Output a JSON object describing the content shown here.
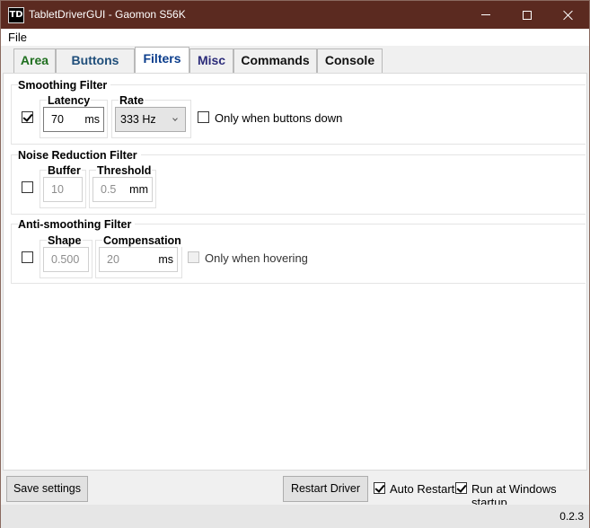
{
  "window": {
    "app_icon": "TD",
    "title": "TabletDriverGUI - Gaomon S56K",
    "controls": [
      "minimize-icon",
      "maximize-icon",
      "close-icon"
    ]
  },
  "menu": {
    "file": "File"
  },
  "tabs": [
    {
      "label": "Area",
      "color": "#1f6f1f"
    },
    {
      "label": "Buttons",
      "color": "#1f4e7a"
    },
    {
      "label": "Filters",
      "color": "#0b3d8c",
      "active": true
    },
    {
      "label": "Misc",
      "color": "#2c2c7a"
    },
    {
      "label": "Commands",
      "color": "#111111"
    },
    {
      "label": "Console",
      "color": "#111111"
    }
  ],
  "smoothing": {
    "title": "Smoothing Filter",
    "enabled": true,
    "latency_label": "Latency",
    "latency_value": "70",
    "latency_unit": "ms",
    "rate_label": "Rate",
    "rate_value": "333 Hz",
    "only_buttons_label": "Only when buttons down",
    "only_buttons_checked": false
  },
  "noise": {
    "title": "Noise Reduction Filter",
    "enabled": false,
    "buffer_label": "Buffer",
    "buffer_value": "10",
    "threshold_label": "Threshold",
    "threshold_value": "0.5",
    "threshold_unit": "mm"
  },
  "antismoothing": {
    "title": "Anti-smoothing Filter",
    "enabled": false,
    "shape_label": "Shape",
    "shape_value": "0.500",
    "compensation_label": "Compensation",
    "compensation_value": "20",
    "compensation_unit": "ms",
    "only_hovering_label": "Only when hovering",
    "only_hovering_checked": false
  },
  "bottom": {
    "save_label": "Save settings",
    "restart_label": "Restart Driver",
    "auto_restart_label": "Auto Restart",
    "auto_restart_checked": true,
    "startup_label": "Run at Windows startup",
    "startup_checked": true
  },
  "status": {
    "version": "0.2.3"
  }
}
